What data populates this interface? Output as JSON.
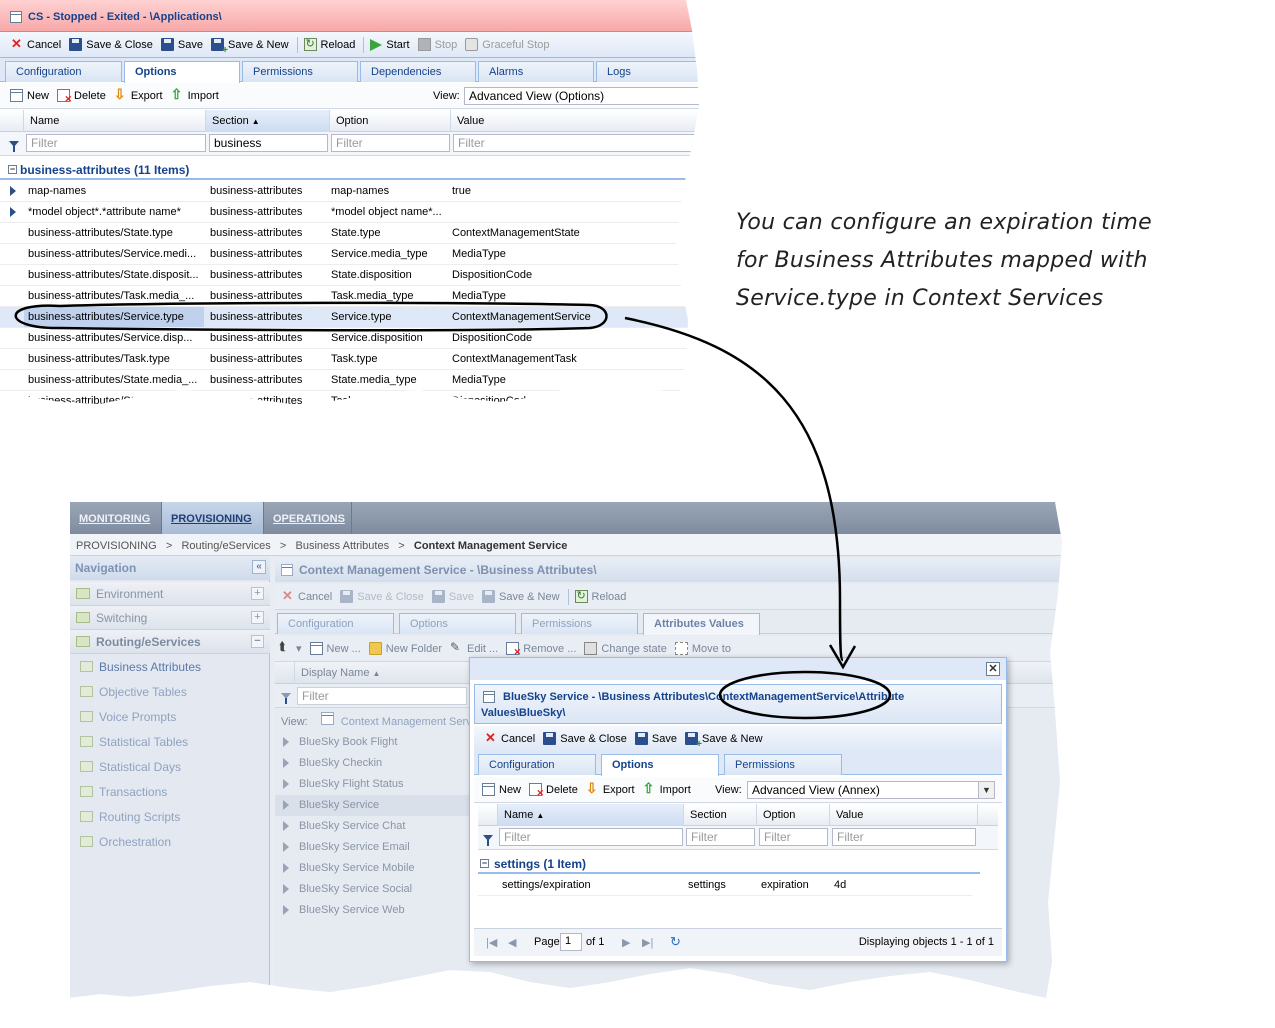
{
  "top": {
    "title": "CS - Stopped - Exited - \\Applications\\",
    "toolbar": {
      "cancel": "Cancel",
      "save_close": "Save & Close",
      "save": "Save",
      "save_new": "Save & New",
      "reload": "Reload",
      "start": "Start",
      "stop": "Stop",
      "graceful_stop": "Graceful Stop"
    },
    "tabs": [
      "Configuration",
      "Options",
      "Permissions",
      "Dependencies",
      "Alarms",
      "Logs"
    ],
    "grid_toolbar": {
      "new": "New",
      "delete": "Delete",
      "export": "Export",
      "import": "Import",
      "view_label": "View:",
      "view_value": "Advanced View (Options)"
    },
    "columns": [
      "Name",
      "Section",
      "Option",
      "Value"
    ],
    "filters": {
      "name": "Filter",
      "section": "business",
      "option": "Filter",
      "value": "Filter"
    },
    "group": "business-attributes (11 Items)",
    "rows": [
      [
        "map-names",
        "business-attributes",
        "map-names",
        "true"
      ],
      [
        "*model object*.*attribute name*",
        "business-attributes",
        "*model object name*...",
        ""
      ],
      [
        "business-attributes/State.type",
        "business-attributes",
        "State.type",
        "ContextManagementState"
      ],
      [
        "business-attributes/Service.medi...",
        "business-attributes",
        "Service.media_type",
        "MediaType"
      ],
      [
        "business-attributes/State.disposit...",
        "business-attributes",
        "State.disposition",
        "DispositionCode"
      ],
      [
        "business-attributes/Task.media_...",
        "business-attributes",
        "Task.media_type",
        "MediaType"
      ],
      [
        "business-attributes/Service.type",
        "business-attributes",
        "Service.type",
        "ContextManagementService"
      ],
      [
        "business-attributes/Service.disp...",
        "business-attributes",
        "Service.disposition",
        "DispositionCode"
      ],
      [
        "business-attributes/Task.type",
        "business-attributes",
        "Task.type",
        "ContextManagementTask"
      ],
      [
        "business-attributes/State.media_...",
        "business-attributes",
        "State.media_type",
        "MediaType"
      ],
      [
        "business-attributes/State.disposit...",
        "business-attributes",
        "Task.disposition",
        "DispositionCode"
      ]
    ]
  },
  "annotation": {
    "lines": [
      "You can configure an expiration time",
      "for Business Attributes mapped with",
      "Service.type in Context Services"
    ]
  },
  "bottom": {
    "topnav": [
      "MONITORING",
      "PROVISIONING",
      "OPERATIONS"
    ],
    "breadcrumb": {
      "p1": "PROVISIONING",
      "sep": ">",
      "p2": "Routing/eServices",
      "p3": "Business Attributes",
      "current": "Context Management Service"
    },
    "navigation": {
      "title": "Navigation",
      "sections": [
        "Environment",
        "Switching",
        "Routing/eServices"
      ],
      "items": [
        "Business Attributes",
        "Objective Tables",
        "Voice Prompts",
        "Statistical Tables",
        "Statistical Days",
        "Transactions",
        "Routing Scripts",
        "Orchestration"
      ]
    },
    "main": {
      "title": "Context Management Service - \\Business Attributes\\",
      "toolbar": {
        "cancel": "Cancel",
        "save_close": "Save & Close",
        "save": "Save",
        "save_new": "Save & New",
        "reload": "Reload"
      },
      "tabs": [
        "Configuration",
        "Options",
        "Permissions",
        "Attributes Values"
      ],
      "list_toolbar": {
        "new": "New ...",
        "new_folder": "New Folder",
        "edit": "Edit ...",
        "remove": "Remove ...",
        "change_state": "Change state",
        "move_to": "Move to"
      },
      "column": "Display Name",
      "filter": "Filter",
      "view_label": "View:",
      "view_value": "Context Management Serv",
      "items": [
        "BlueSky Book Flight",
        "BlueSky Checkin",
        "BlueSky Flight Status",
        "BlueSky Service",
        "BlueSky Service Chat",
        "BlueSky Service Email",
        "BlueSky Service Mobile",
        "BlueSky Service Social",
        "BlueSky Service Web"
      ]
    },
    "dialog": {
      "title_line1": "BlueSky Service - \\Business Attributes\\ContextManagementService\\Attribute",
      "title_line2": "Values\\BlueSky\\",
      "toolbar": {
        "cancel": "Cancel",
        "save_close": "Save & Close",
        "save": "Save",
        "save_new": "Save & New"
      },
      "tabs": [
        "Configuration",
        "Options",
        "Permissions"
      ],
      "grid_toolbar": {
        "new": "New",
        "delete": "Delete",
        "export": "Export",
        "import": "Import",
        "view_label": "View:",
        "view_value": "Advanced View (Annex)"
      },
      "columns": [
        "Name",
        "Section",
        "Option",
        "Value"
      ],
      "filter": "Filter",
      "group": "settings (1 Item)",
      "row": [
        "settings/expiration",
        "settings",
        "expiration",
        "4d"
      ],
      "pager": {
        "page_label": "Page",
        "page_value": "1",
        "of": "of 1",
        "displaying": "Displaying objects 1 - 1 of 1"
      }
    }
  }
}
